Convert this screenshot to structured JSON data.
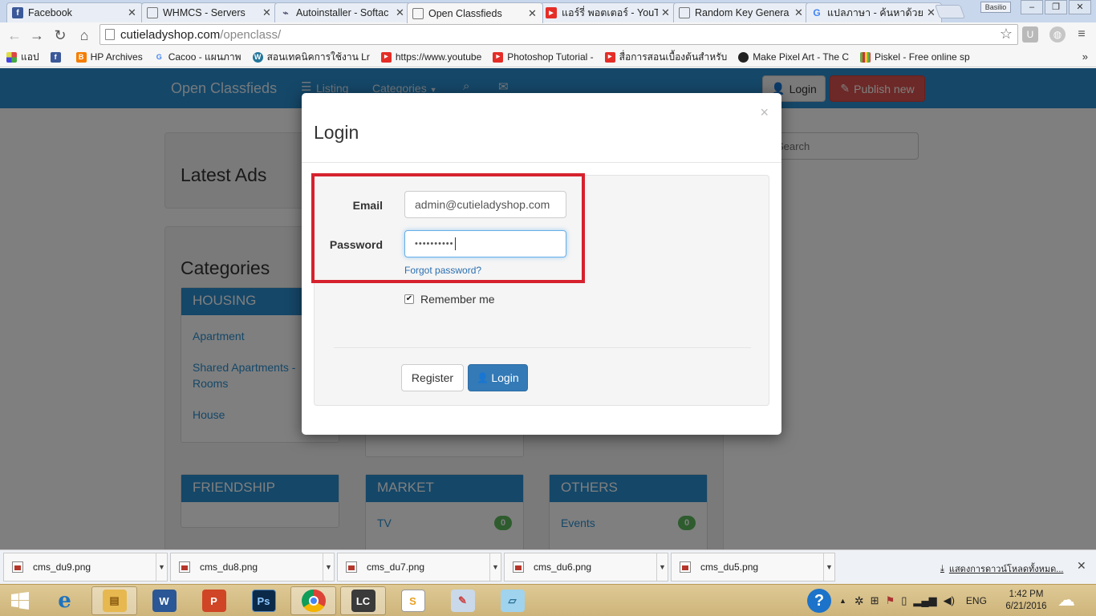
{
  "browser": {
    "tabs": [
      {
        "title": "Facebook",
        "icon": "facebook-icon",
        "color": "#3b5998",
        "glyph": "f"
      },
      {
        "title": "WHMCS - Servers",
        "icon": "page-icon",
        "color": "#ffffff",
        "glyph": ""
      },
      {
        "title": "Autoinstaller - Softac",
        "icon": "softaculous-icon",
        "color": "#7aa7c7",
        "glyph": "~"
      },
      {
        "title": "Open Classfieds",
        "icon": "page-icon",
        "color": "#ffffff",
        "glyph": ""
      },
      {
        "title": "แอร์รี่ พอตเตอร์ - YouTu",
        "icon": "youtube-icon",
        "color": "#e52d27",
        "glyph": "▶"
      },
      {
        "title": "Random Key Genera",
        "icon": "page-icon",
        "color": "#ffffff",
        "glyph": ""
      },
      {
        "title": "แปลภาษา - ค้นหาด้วย G",
        "icon": "google-icon",
        "color": "#4285f4",
        "glyph": "G"
      }
    ],
    "user_badge": "Basilio",
    "url_host": "cutieladyshop.com",
    "url_path": "/openclass/",
    "bookmarks": [
      {
        "label": "แอป",
        "icon": "apps-icon",
        "color": "#d44"
      },
      {
        "label": "",
        "icon": "facebook-icon",
        "color": "#3b5998"
      },
      {
        "label": "HP Archives",
        "icon": "blogger-icon",
        "color": "#f57d00"
      },
      {
        "label": "Cacoo - แผนภาพ",
        "icon": "google-icon",
        "color": "#4285f4"
      },
      {
        "label": "สอนเทคนิคการใช้งาน Lr",
        "icon": "wordpress-icon",
        "color": "#21759b"
      },
      {
        "label": "https://www.youtube",
        "icon": "youtube-icon",
        "color": "#e52d27"
      },
      {
        "label": "Photoshop Tutorial -",
        "icon": "youtube-icon",
        "color": "#e52d27"
      },
      {
        "label": "สื่อการสอนเบื้องต้นสำหรับ",
        "icon": "youtube-icon",
        "color": "#e52d27"
      },
      {
        "label": "Make Pixel Art - The C",
        "icon": "bomb-icon",
        "color": "#222"
      },
      {
        "label": "Piskel - Free online sp",
        "icon": "piskel-icon",
        "color": "#6a4"
      }
    ]
  },
  "site": {
    "brand": "Open Classfieds",
    "nav": {
      "listing": "Listing",
      "categories": "Categories"
    },
    "login_button": "Login",
    "publish_button": "Publish new",
    "search_placeholder": "Search",
    "latest_ads_heading": "Latest Ads",
    "categories_heading": "Categories",
    "category_boxes": {
      "housing": {
        "title": "HOUSING",
        "items": [
          "Apartment",
          "Shared Apartments - Rooms",
          "House"
        ]
      },
      "friendship": {
        "title": "FRIENDSHIP"
      },
      "market": {
        "title": "MARKET",
        "items": [
          {
            "label": "TV",
            "count": "0"
          }
        ]
      },
      "others": {
        "title": "OTHERS",
        "items": [
          {
            "label": "Events",
            "count": "0"
          }
        ]
      }
    }
  },
  "modal": {
    "title": "Login",
    "close": "×",
    "email_label": "Email",
    "email_value": "admin@cutieladyshop.com",
    "password_label": "Password",
    "password_value": "••••••••••",
    "forgot_link": "Forgot password?",
    "remember_label": "Remember me",
    "remember_checked": true,
    "register_button": "Register",
    "login_button": "Login",
    "highlight_color": "#d6222e"
  },
  "downloads": {
    "items": [
      "cms_du9.png",
      "cms_du8.png",
      "cms_du7.png",
      "cms_du6.png",
      "cms_du5.png"
    ],
    "show_all": "แสดงการดาวน์โหลดทั้งหมด..."
  },
  "taskbar": {
    "apps": [
      {
        "name": "internet-explorer",
        "glyph": "e",
        "color": "#1e73be"
      },
      {
        "name": "file-explorer",
        "glyph": "▤",
        "color": "#d8a33a"
      },
      {
        "name": "word",
        "glyph": "W",
        "color": "#2b5797"
      },
      {
        "name": "powerpoint",
        "glyph": "P",
        "color": "#d04525"
      },
      {
        "name": "photoshop",
        "glyph": "Ps",
        "color": "#0b2a4a"
      },
      {
        "name": "chrome",
        "glyph": "◉",
        "color": "#db4437"
      },
      {
        "name": "lc",
        "glyph": "LC",
        "color": "#3a3a3a"
      },
      {
        "name": "sketchbook",
        "glyph": "S",
        "color": "#e8a020"
      },
      {
        "name": "paint",
        "glyph": "✎",
        "color": "#7b9ec7"
      },
      {
        "name": "notes",
        "glyph": "▱",
        "color": "#5fb0d8"
      }
    ],
    "language": "ENG",
    "time": "1:42 PM",
    "date": "6/21/2016"
  }
}
